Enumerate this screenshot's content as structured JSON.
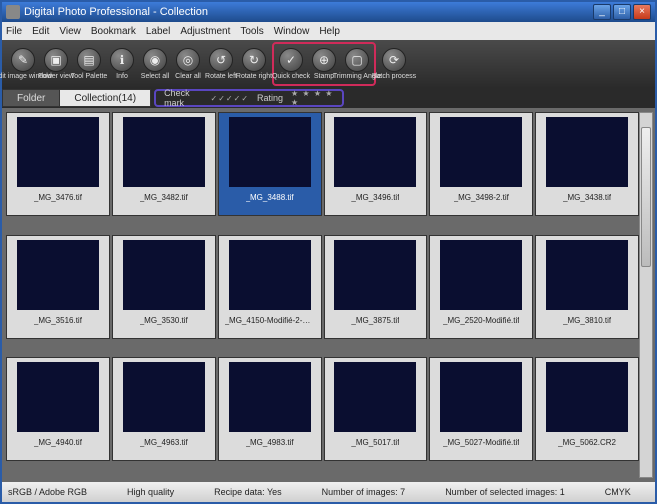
{
  "window": {
    "title": "Digital Photo Professional - Collection",
    "min": "_",
    "max": "□",
    "close": "×"
  },
  "menu": [
    "File",
    "Edit",
    "View",
    "Bookmark",
    "Label",
    "Adjustment",
    "Tools",
    "Window",
    "Help"
  ],
  "toolbar": [
    {
      "label": "Edit image window",
      "icon": "✎"
    },
    {
      "label": "Folder view",
      "icon": "▣"
    },
    {
      "label": "Tool Palette",
      "icon": "▤"
    },
    {
      "label": "Info",
      "icon": "ℹ"
    },
    {
      "label": "Select all",
      "icon": "◉"
    },
    {
      "label": "Clear all",
      "icon": "◎"
    },
    {
      "label": "Rotate left",
      "icon": "↺"
    },
    {
      "label": "Rotate right",
      "icon": "↻"
    }
  ],
  "toolbarHighlighted": [
    {
      "label": "Quick check",
      "icon": "✓"
    },
    {
      "label": "Stamp",
      "icon": "⊕"
    },
    {
      "label": "Trimming Angle",
      "icon": "▢"
    }
  ],
  "toolbarAfter": [
    {
      "label": "Batch process",
      "icon": "⟳"
    }
  ],
  "tabs": {
    "folder": "Folder",
    "collection": "Collection(14)"
  },
  "rating": {
    "checkLabel": "Check mark",
    "checks": "✓✓✓✓✓",
    "ratingLabel": "Rating",
    "stars": "★ ★ ★ ★ ★"
  },
  "thumbs": [
    {
      "name": "_MG_3476.tif",
      "cls": "night-castle"
    },
    {
      "name": "_MG_3482.tif",
      "cls": "night-dome"
    },
    {
      "name": "_MG_3488.tif",
      "cls": "night-dome",
      "selected": true
    },
    {
      "name": "_MG_3496.tif",
      "cls": "night-trees"
    },
    {
      "name": "_MG_3498-2.tif",
      "cls": "night-blue"
    },
    {
      "name": "_MG_3438.tif",
      "cls": "night-wide"
    },
    {
      "name": "_MG_3516.tif",
      "cls": "night-fern"
    },
    {
      "name": "_MG_3530.tif",
      "cls": "night-fern2"
    },
    {
      "name": "_MG_4150-Modifié-2-M...",
      "cls": "caterpillar"
    },
    {
      "name": "_MG_3875.tif",
      "cls": "leaf"
    },
    {
      "name": "_MG_2520-Modifié.tif",
      "cls": "flower"
    },
    {
      "name": "_MG_3810.tif",
      "cls": "grass"
    },
    {
      "name": "_MG_4940.tif",
      "cls": "drops1"
    },
    {
      "name": "_MG_4963.tif",
      "cls": "drops2"
    },
    {
      "name": "_MG_4983.tif",
      "cls": "drops3"
    },
    {
      "name": "_MG_5017.tif",
      "cls": "drops4"
    },
    {
      "name": "_MG_5027-Modifié.tif",
      "cls": "drops5"
    },
    {
      "name": "_MG_5062.CR2",
      "cls": "moss"
    }
  ],
  "status": {
    "color": "sRGB / Adobe RGB",
    "quality": "High quality",
    "recipe": "Recipe data: Yes",
    "count": "Number of images: 7",
    "selected": "Number of selected images: 1",
    "cmyk": "CMYK"
  }
}
